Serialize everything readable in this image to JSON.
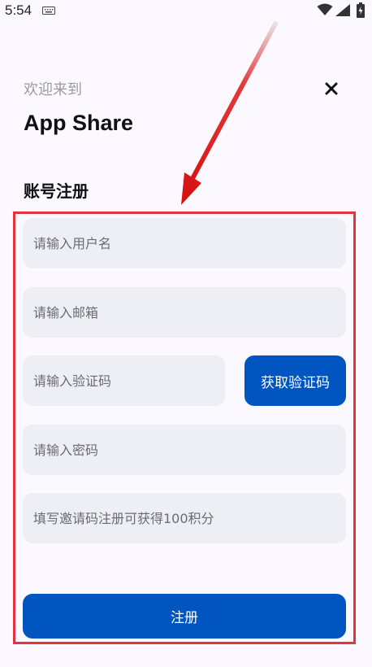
{
  "status_bar": {
    "time": "5:54",
    "icons": [
      "keyboard-icon",
      "wifi-icon",
      "signal-icon",
      "battery-icon"
    ]
  },
  "header": {
    "welcome_text": "欢迎来到",
    "app_name": "App Share",
    "close_icon": "close-icon"
  },
  "form": {
    "section_title": "账号注册",
    "username_placeholder": "请输入用户名",
    "email_placeholder": "请输入邮箱",
    "code_placeholder": "请输入验证码",
    "get_code_label": "获取验证码",
    "password_placeholder": "请输入密码",
    "invite_placeholder": "填写邀请码注册可获得100积分",
    "register_label": "注册"
  },
  "colors": {
    "primary": "#0055c0",
    "field_background": "#eeeef5",
    "annotation": "#e5333b",
    "page_background": "#fbf8ff"
  }
}
